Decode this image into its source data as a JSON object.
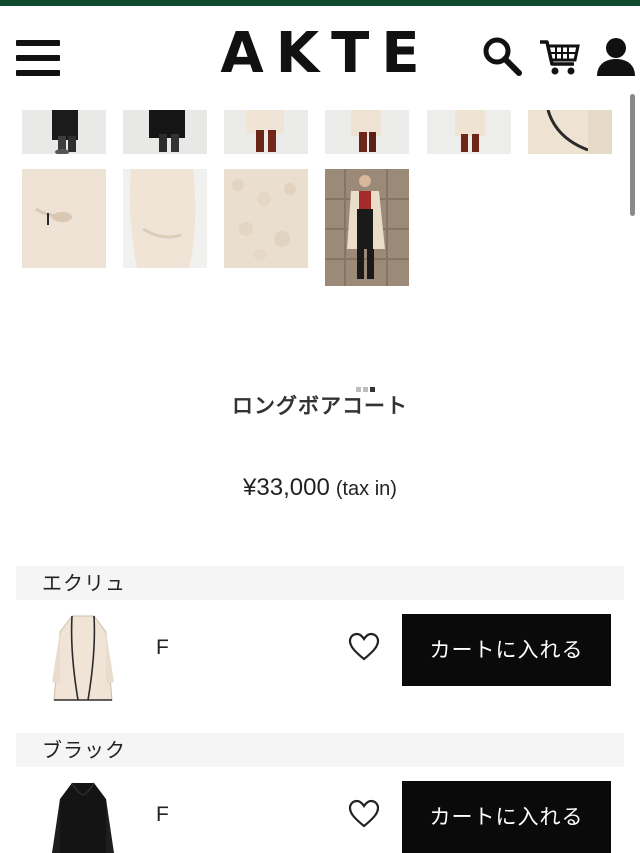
{
  "header": {
    "logo": "AKTE",
    "menu_icon": "hamburger-menu-icon",
    "search_icon": "search-icon",
    "cart_icon": "cart-icon",
    "user_icon": "user-icon",
    "accent_color": "#0f4a2c"
  },
  "gallery": {
    "thumbnails": [
      "model-wearing-coat-legs-1",
      "model-wearing-coat-legs-2",
      "model-wearing-coat-back-legs",
      "model-wearing-coat-side-legs",
      "coat-hem-closeup",
      "coat-collar-closeup",
      "coat-pocket-detail",
      "coat-sleeve-detail",
      "boa-fabric-texture",
      "model-full-body-street"
    ],
    "indicator_count": 3,
    "indicator_active": 3
  },
  "product": {
    "name": "ロングボアコート",
    "price": "¥33,000",
    "tax": "(tax in)"
  },
  "variants": [
    {
      "color": "エクリュ",
      "size": "F",
      "button": "カートに入れる",
      "swatch_color": "#efe4d6",
      "image_icon": "ecru-coat-icon",
      "favorite_icon": "heart-outline-icon"
    },
    {
      "color": "ブラック",
      "size": "F",
      "button": "カートに入れる",
      "swatch_color": "#141414",
      "image_icon": "black-coat-icon",
      "favorite_icon": "heart-outline-icon"
    }
  ]
}
